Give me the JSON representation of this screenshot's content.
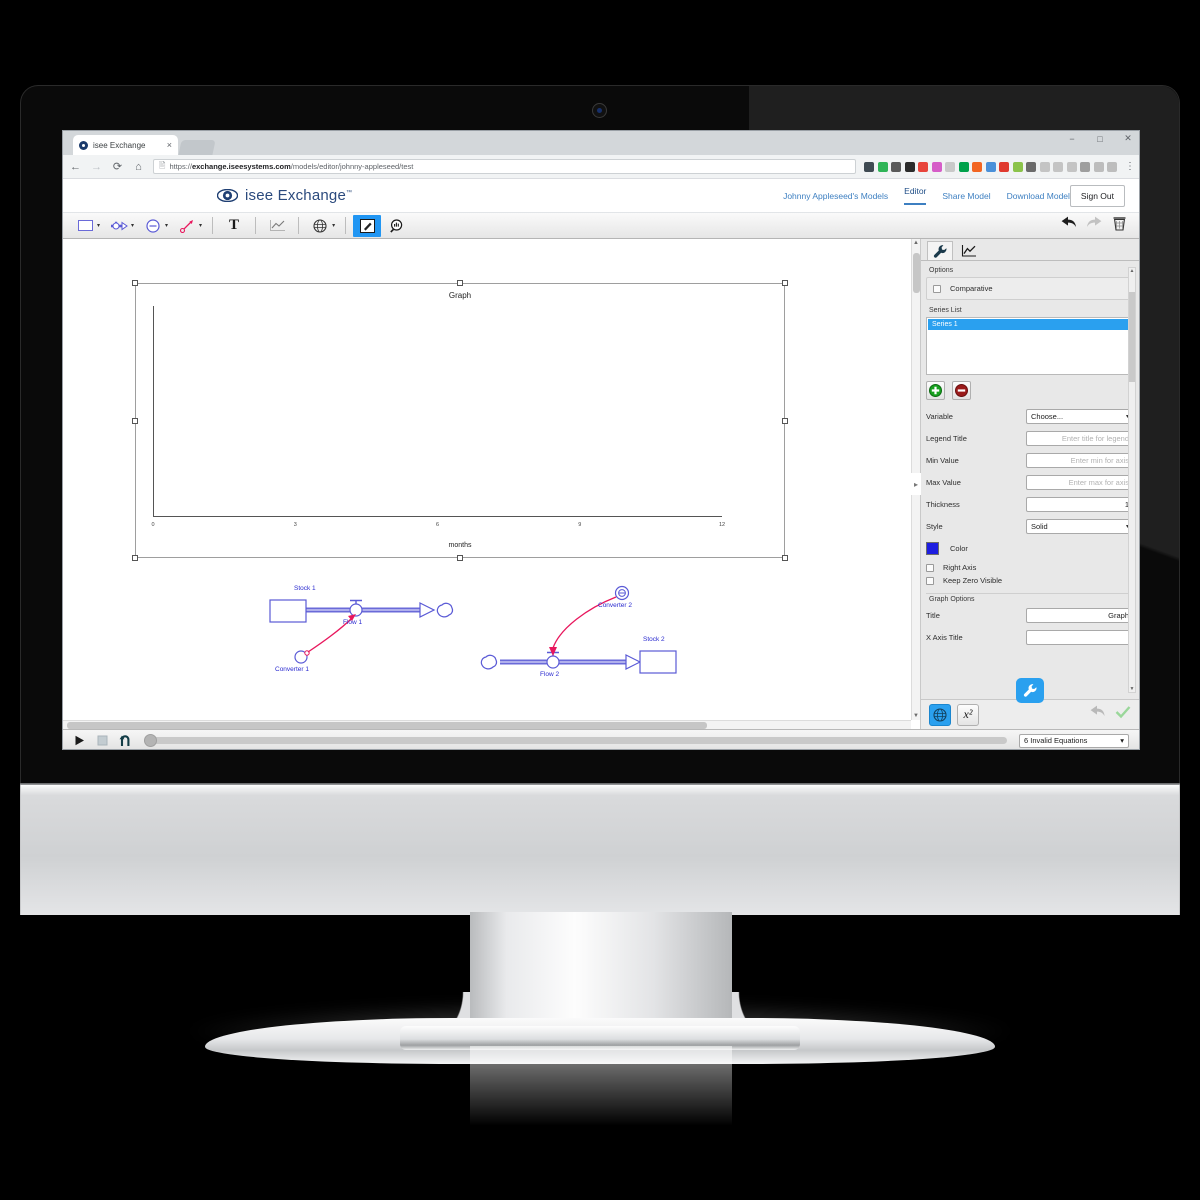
{
  "browser": {
    "tab": {
      "title": "isee Exchange",
      "favicon_name": "isee-eye-favicon",
      "close_label": "×"
    },
    "new_tab_label": "+",
    "window_controls": {
      "minimize": "−",
      "maximize": "□",
      "close": "✕"
    },
    "nav": {
      "back": "←",
      "forward": "→",
      "reload": "⟳",
      "home": "⌂"
    },
    "url": {
      "secure_icon": "page-icon",
      "prefix": "https://",
      "domain": "exchange.iseesystems.com",
      "path": "/models/editor/johnny-appleseed/test"
    },
    "extensions": [
      {
        "name": "mail-extension",
        "color": "#3f4a52"
      },
      {
        "name": "bubble-extension",
        "color": "#2fb457"
      },
      {
        "name": "pin-extension",
        "color": "#5a5a5a"
      },
      {
        "name": "function-extension",
        "color": "#2b2b2b"
      },
      {
        "name": "f-extension",
        "color": "#e8453c"
      },
      {
        "name": "gradient-extension",
        "color": "#d65dc8"
      },
      {
        "name": "grey-extension",
        "color": "#c9c9c9"
      },
      {
        "name": "green-circle-extension",
        "color": "#00a14b"
      },
      {
        "name": "chart-extension",
        "color": "#f26522"
      },
      {
        "name": "photo-extension",
        "color": "#4a90d9"
      },
      {
        "name": "office-extension",
        "color": "#e03a2f"
      },
      {
        "name": "note-extension",
        "color": "#8bc34a"
      },
      {
        "name": "link-extension",
        "color": "#6b6b6b"
      },
      {
        "name": "grey2-extension",
        "color": "#c4c4c4"
      },
      {
        "name": "grey3-extension",
        "color": "#c4c4c4"
      },
      {
        "name": "l-extension",
        "color": "#c4c4c4"
      },
      {
        "name": "tag-extension",
        "color": "#9e9e9e"
      },
      {
        "name": "card-extension",
        "color": "#bdbdbd"
      },
      {
        "name": "circle-extension",
        "color": "#bdbdbd"
      }
    ],
    "menu_label": "⋮"
  },
  "app": {
    "brand": {
      "name": "isee Exchange",
      "trademark": "™"
    },
    "nav": [
      {
        "label": "Johnny Appleseed's Models",
        "active": false
      },
      {
        "label": "Editor",
        "active": true
      },
      {
        "label": "Share Model",
        "active": false
      },
      {
        "label": "Download Model",
        "active": false
      }
    ],
    "signout_label": "Sign Out"
  },
  "toolbar": {
    "items": [
      {
        "name": "stock-tool",
        "caret": true
      },
      {
        "name": "flow-tool",
        "caret": true
      },
      {
        "name": "converter-tool",
        "caret": true
      },
      {
        "name": "connector-tool",
        "caret": true
      },
      {
        "name": "text-tool",
        "label": "T",
        "caret": false
      },
      {
        "name": "graph-tool",
        "caret": false
      },
      {
        "name": "globe-tool",
        "caret": true
      },
      {
        "name": "edit-tool",
        "caret": false,
        "active": true
      },
      {
        "name": "zoom-tool",
        "caret": false
      }
    ],
    "undo_label": "undo-icon",
    "redo_label": "redo-icon",
    "trash_label": "trash-icon"
  },
  "canvas": {
    "graph": {
      "title": "Graph",
      "x_axis_title": "months",
      "x_ticks": [
        "0",
        "3",
        "6",
        "9",
        "12"
      ],
      "selected": true
    },
    "diagram": {
      "nodes": [
        {
          "name": "stock-1",
          "label": "Stock 1",
          "type": "stock"
        },
        {
          "name": "flow-1",
          "label": "Flow 1",
          "type": "flow"
        },
        {
          "name": "converter-1",
          "label": "Converter 1",
          "type": "converter"
        },
        {
          "name": "converter-2",
          "label": "Converter 2",
          "type": "converter"
        },
        {
          "name": "flow-2",
          "label": "Flow 2",
          "type": "flow"
        },
        {
          "name": "stock-2",
          "label": "Stock 2",
          "type": "stock"
        }
      ]
    }
  },
  "panel": {
    "tabs": [
      {
        "name": "properties-tab",
        "icon": "wrench-icon",
        "selected": true
      },
      {
        "name": "graph-tab",
        "icon": "chart-icon",
        "selected": false
      }
    ],
    "options_label": "Options",
    "comparative": {
      "label": "Comparative",
      "checked": false
    },
    "series_list_label": "Series List",
    "series": [
      {
        "label": "Series 1",
        "selected": true
      }
    ],
    "add_label": "+",
    "remove_label": "−",
    "fields": [
      {
        "name": "variable",
        "label": "Variable",
        "type": "select",
        "value": "Choose...",
        "placeholder": ""
      },
      {
        "name": "legend-title",
        "label": "Legend Title",
        "type": "text",
        "value": "",
        "placeholder": "Enter title for legend"
      },
      {
        "name": "min-value",
        "label": "Min Value",
        "type": "text",
        "value": "",
        "placeholder": "Enter min for axis"
      },
      {
        "name": "max-value",
        "label": "Max Value",
        "type": "text",
        "value": "",
        "placeholder": "Enter max for axis"
      },
      {
        "name": "thickness",
        "label": "Thickness",
        "type": "number",
        "value": "1",
        "placeholder": ""
      },
      {
        "name": "style",
        "label": "Style",
        "type": "select",
        "value": "Solid",
        "placeholder": ""
      }
    ],
    "color": {
      "label": "Color",
      "hex": "#1d1de0"
    },
    "right_axis": {
      "label": "Right Axis",
      "checked": false
    },
    "keep_zero_visible": {
      "label": "Keep Zero Visible",
      "checked": false
    },
    "graph_options_label": "Graph Options",
    "graph_fields": [
      {
        "name": "graph-title",
        "label": "Title",
        "value": "Graph"
      },
      {
        "name": "x-axis-title",
        "label": "X Axis Title",
        "value": ""
      }
    ],
    "footer": {
      "globe": "globe-icon",
      "equation": "x²",
      "undo": "undo-icon",
      "confirm": "check-icon",
      "fab": "wrench-icon"
    }
  },
  "statusbar": {
    "run_label": "run-icon",
    "pause_label": "pause-icon",
    "reset_label": "reset-icon",
    "slider_value": "0",
    "status_select": {
      "value": "6 Invalid Equations",
      "caret": "▾"
    }
  },
  "colors": {
    "accent_blue": "#2aa0ef",
    "brand_navy": "#2b4a7d",
    "link_blue": "#3d7fc1",
    "diagram_blue": "#4a4ae0",
    "diagram_red": "#e8175d",
    "series_color": "#1d1de0"
  }
}
